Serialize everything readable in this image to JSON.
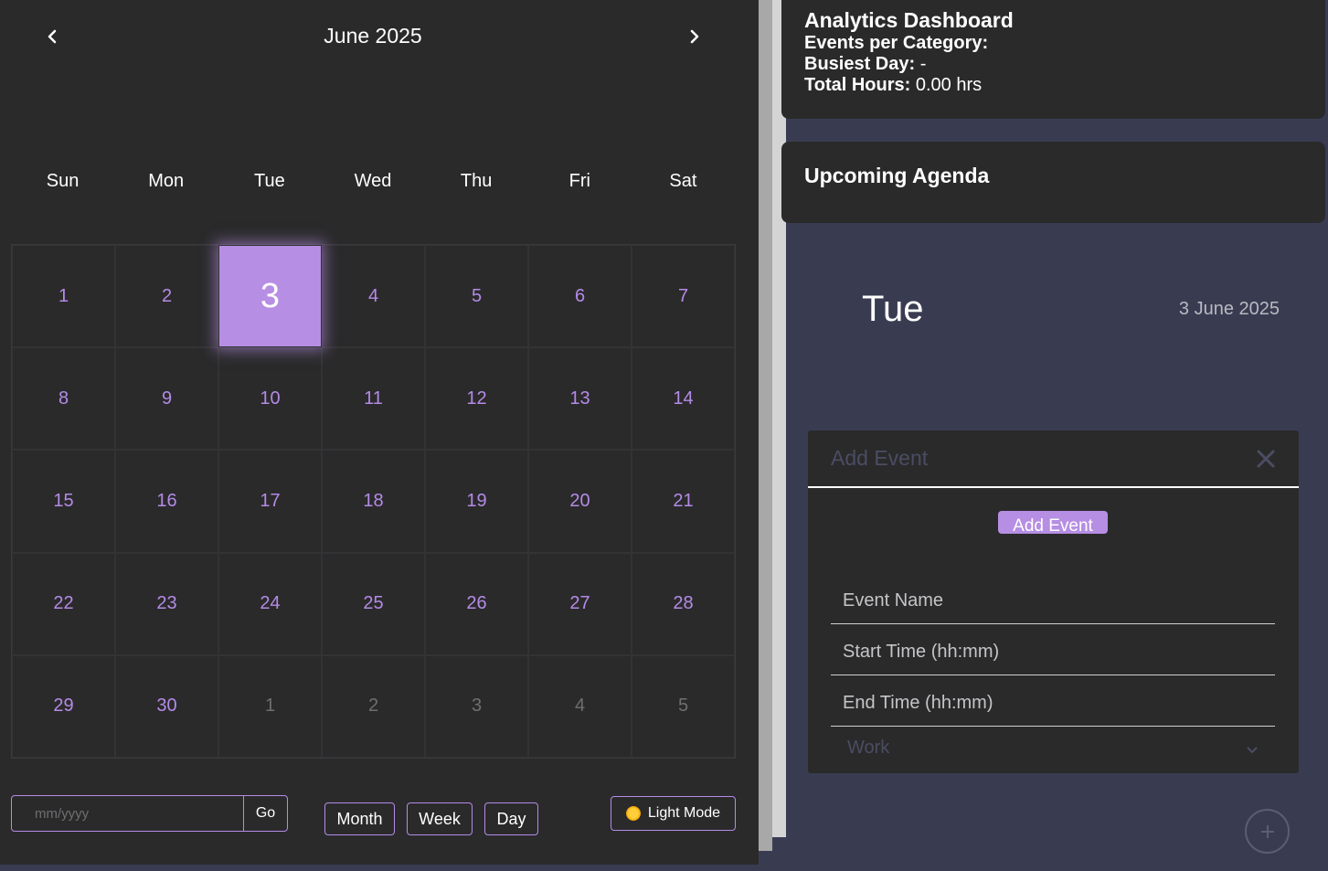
{
  "calendar": {
    "title": "June 2025",
    "weekdays": [
      "Sun",
      "Mon",
      "Tue",
      "Wed",
      "Thu",
      "Fri",
      "Sat"
    ],
    "days": [
      {
        "n": "1",
        "other": false
      },
      {
        "n": "2",
        "other": false
      },
      {
        "n": "3",
        "other": false,
        "today": true
      },
      {
        "n": "4",
        "other": false
      },
      {
        "n": "5",
        "other": false
      },
      {
        "n": "6",
        "other": false
      },
      {
        "n": "7",
        "other": false
      },
      {
        "n": "8",
        "other": false
      },
      {
        "n": "9",
        "other": false
      },
      {
        "n": "10",
        "other": false
      },
      {
        "n": "11",
        "other": false
      },
      {
        "n": "12",
        "other": false
      },
      {
        "n": "13",
        "other": false
      },
      {
        "n": "14",
        "other": false
      },
      {
        "n": "15",
        "other": false
      },
      {
        "n": "16",
        "other": false
      },
      {
        "n": "17",
        "other": false
      },
      {
        "n": "18",
        "other": false
      },
      {
        "n": "19",
        "other": false
      },
      {
        "n": "20",
        "other": false
      },
      {
        "n": "21",
        "other": false
      },
      {
        "n": "22",
        "other": false
      },
      {
        "n": "23",
        "other": false
      },
      {
        "n": "24",
        "other": false
      },
      {
        "n": "25",
        "other": false
      },
      {
        "n": "26",
        "other": false
      },
      {
        "n": "27",
        "other": false
      },
      {
        "n": "28",
        "other": false
      },
      {
        "n": "29",
        "other": false
      },
      {
        "n": "30",
        "other": false
      },
      {
        "n": "1",
        "other": true
      },
      {
        "n": "2",
        "other": true
      },
      {
        "n": "3",
        "other": true
      },
      {
        "n": "4",
        "other": true
      },
      {
        "n": "5",
        "other": true
      }
    ],
    "prev_icon": "chevron-left-icon",
    "next_icon": "chevron-right-icon"
  },
  "toolbar": {
    "date_placeholder": "mm/yyyy",
    "go_label": "Go",
    "month_label": "Month",
    "week_label": "Week",
    "day_label": "Day",
    "theme_label": "Light Mode",
    "theme_icon": "sun-icon"
  },
  "analytics": {
    "title": "Analytics Dashboard",
    "events_label": "Events per Category:",
    "events_value": "",
    "busiest_label": "Busiest Day:",
    "busiest_value": " -",
    "hours_label": "Total Hours:",
    "hours_value": " 0.00 hrs"
  },
  "agenda": {
    "title": "Upcoming Agenda"
  },
  "selected_day": {
    "name": "Tue",
    "date": "3 June 2025"
  },
  "modal": {
    "title": "Add Event",
    "add_button": "Add Event",
    "event_name_placeholder": "Event Name",
    "start_placeholder": "Start Time (hh:mm)",
    "end_placeholder": "End Time (hh:mm)",
    "category_value": "Work"
  },
  "colors": {
    "accent": "#b68ee3",
    "panel": "#2a2a2b",
    "background": "#393c51"
  }
}
